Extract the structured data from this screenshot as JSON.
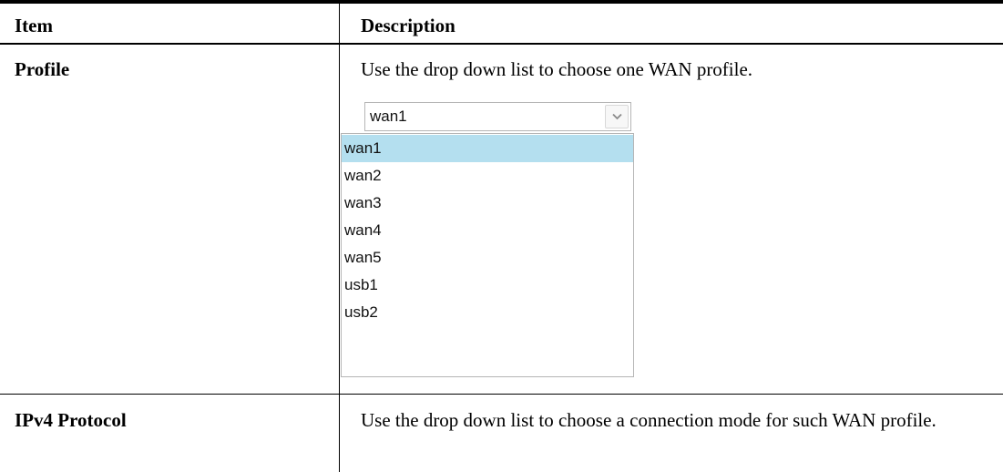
{
  "table": {
    "header": {
      "item": "Item",
      "description": "Description"
    },
    "rows": [
      {
        "item": "Profile",
        "description": "Use the drop down list to choose one WAN profile."
      },
      {
        "item": "IPv4 Protocol",
        "description": "Use the drop down list to choose a connection mode for such WAN profile."
      }
    ]
  },
  "profile_select": {
    "selected_value": "wan1",
    "arrow_icon": "chevron-down-icon",
    "options": [
      "wan1",
      "wan2",
      "wan3",
      "wan4",
      "wan5",
      "usb1",
      "usb2"
    ],
    "highlighted_option": "wan1"
  },
  "colors": {
    "highlight": "#b4dfef",
    "border": "#b5b5b5",
    "rule": "#000000"
  }
}
